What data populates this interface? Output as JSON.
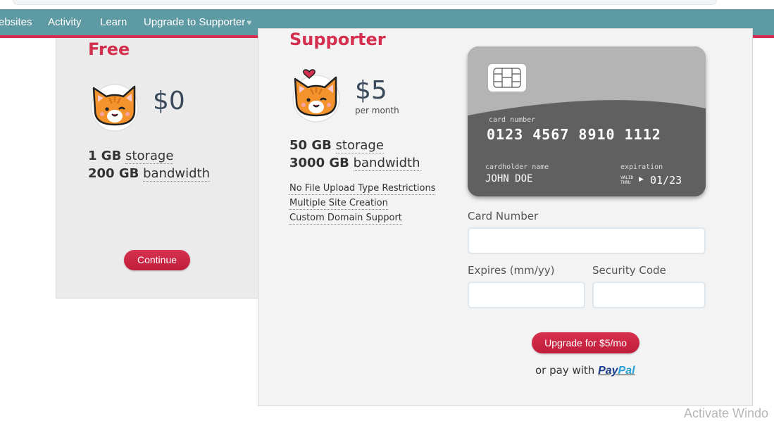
{
  "nav": {
    "items": [
      "ebsites",
      "Activity",
      "Learn",
      "Upgrade to Supporter"
    ],
    "heart": "♥"
  },
  "free_plan": {
    "title": "Free",
    "price": "$0",
    "storage_amount": "1 GB",
    "storage_label": "storage",
    "bandwidth_amount": "200 GB",
    "bandwidth_label": "bandwidth",
    "button": "Continue"
  },
  "supporter_plan": {
    "title": "Supporter",
    "price": "$5",
    "period": "per month",
    "storage_amount": "50 GB",
    "storage_label": "storage",
    "bandwidth_amount": "3000 GB",
    "bandwidth_label": "bandwidth",
    "features": [
      "No File Upload Type Restrictions",
      "Multiple Site Creation",
      "Custom Domain Support"
    ]
  },
  "card_preview": {
    "number_label": "card number",
    "number": "0123 4567 8910 1112",
    "holder_label": "cardholder name",
    "holder": "JOHN DOE",
    "expiration_label": "expiration",
    "valid_thru": "VALID\nTHRU",
    "expiration": "01/23"
  },
  "form": {
    "card_number_label": "Card Number",
    "expires_label": "Expires (mm/yy)",
    "security_code_label": "Security Code",
    "submit": "Upgrade for $5/mo",
    "or_pay_with": "or pay with",
    "paypal_1": "Pay",
    "paypal_2": "Pal"
  },
  "watermark": "Activate Windo",
  "colors": {
    "nav_bg": "#5e9aa3",
    "accent": "#d42f4e",
    "button": "#c9203f"
  }
}
